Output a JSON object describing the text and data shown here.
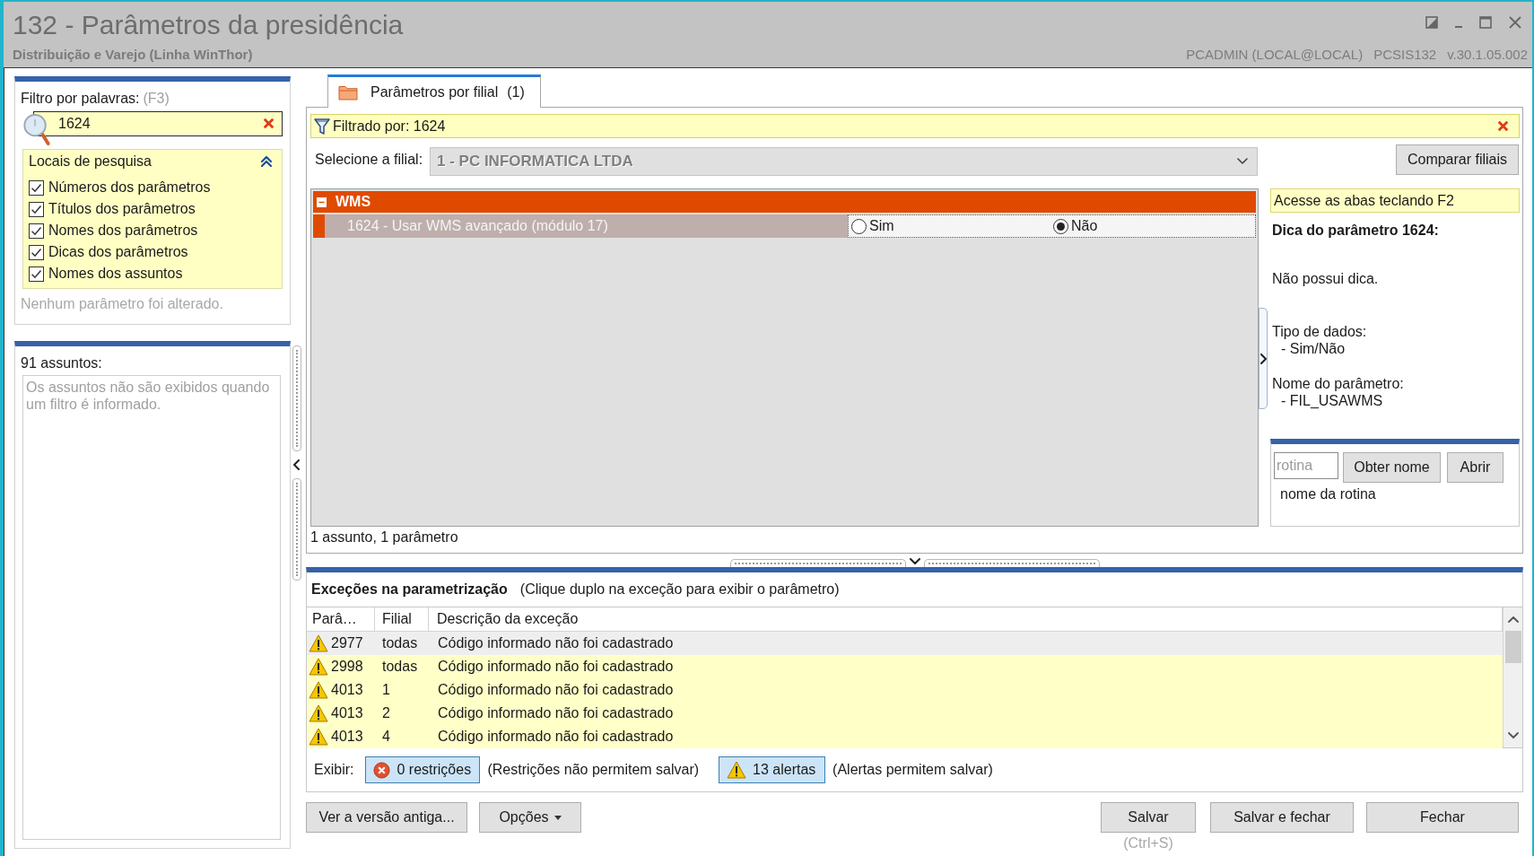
{
  "window": {
    "title": "132 - Parâmetros da presidência",
    "subtitle": "Distribuição e Varejo (Linha WinThor)",
    "user": "PCADMIN (LOCAL@LOCAL)",
    "program": "PCSIS132",
    "version": "v.30.1.05.002"
  },
  "filter_panel": {
    "label": "Filtro por palavras:",
    "shortcut": "(F3)",
    "search": {
      "value": "1624"
    },
    "search_locations": {
      "title": "Locais de pesquisa",
      "expanded": true,
      "options": [
        {
          "label": "Números dos parâmetros",
          "checked": true
        },
        {
          "label": "Títulos dos parâmetros",
          "checked": true
        },
        {
          "label": "Nomes dos parâmetros",
          "checked": true
        },
        {
          "label": "Dicas dos parâmetros",
          "checked": true
        },
        {
          "label": "Nomes dos assuntos",
          "checked": true
        }
      ]
    },
    "status": "Nenhum parâmetro foi alterado."
  },
  "subjects_panel": {
    "count_label": "91 assuntos:",
    "message": "Os assuntos não são exibidos quando um filtro é informado."
  },
  "tabs": [
    {
      "label": "Parâmetros por filial",
      "count": "(1)",
      "selected": true
    }
  ],
  "filter_bar": {
    "text": "Filtrado por: 1624"
  },
  "branch_select": {
    "label": "Selecione a filial:",
    "value": "1 - PC INFORMATICA LTDA",
    "disabled": true
  },
  "compare_button": "Comparar filiais",
  "parameter_groups": [
    {
      "name": "WMS",
      "expanded": true,
      "parameters": [
        {
          "label": "1624 - Usar WMS avançado (módulo 17)",
          "options": [
            {
              "label": "Sim",
              "selected": false
            },
            {
              "label": "Não",
              "selected": true
            }
          ]
        }
      ]
    }
  ],
  "summary": "1 assunto, 1 parâmetro",
  "hint_panel": {
    "notice": "Acesse as abas teclando F2",
    "title": "Dica do parâmetro 1624:",
    "tip": "Não possui dica.",
    "details": [
      {
        "heading": "Tipo de dados:",
        "value": "- Sim/Não"
      },
      {
        "heading": "Nome do parâmetro:",
        "value": "- FIL_USAWMS"
      }
    ]
  },
  "routine": {
    "placeholder": "rotina",
    "buttons": [
      "Obter nome",
      "Abrir"
    ],
    "name": "nome da rotina"
  },
  "exceptions": {
    "title": "Exceções na parametrização",
    "note": "(Clique duplo na exceção para exibir o parâmetro)",
    "columns": [
      "Parâ…",
      "Filial",
      "Descrição da exceção"
    ],
    "rows": [
      {
        "kind": "alert",
        "selected": true,
        "cells": [
          "2977",
          "todas",
          "Código informado não foi cadastrado"
        ]
      },
      {
        "kind": "alert",
        "selected": false,
        "cells": [
          "2998",
          "todas",
          "Código informado não foi cadastrado"
        ]
      },
      {
        "kind": "alert",
        "selected": false,
        "cells": [
          "4013",
          "1",
          "Código informado não foi cadastrado"
        ]
      },
      {
        "kind": "alert",
        "selected": false,
        "cells": [
          "4013",
          "2",
          "Código informado não foi cadastrado"
        ]
      },
      {
        "kind": "alert",
        "selected": false,
        "cells": [
          "4013",
          "4",
          "Código informado não foi cadastrado"
        ]
      }
    ],
    "show_label": "Exibir:",
    "toggles": [
      {
        "kind": "restriction",
        "label": "0 restrições",
        "on": true,
        "note": "(Restrições não permitem salvar)"
      },
      {
        "kind": "alert",
        "label": "13 alertas",
        "on": true,
        "note": "(Alertas permitem salvar)"
      }
    ]
  },
  "footer": {
    "left_buttons": [
      {
        "label": "Ver a versão antiga...",
        "kind": "plain"
      },
      {
        "label": "Opções",
        "kind": "menu"
      }
    ],
    "right_buttons": [
      "Salvar",
      "Salvar e fechar",
      "Fechar"
    ],
    "shortcut": "(Ctrl+S)"
  }
}
